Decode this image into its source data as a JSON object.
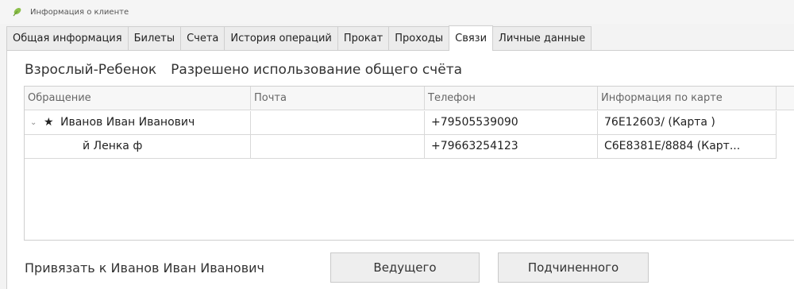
{
  "window": {
    "title": "Информация о клиенте",
    "icon": "leaf-icon"
  },
  "tabs": [
    {
      "label": "Общая информация",
      "active": false
    },
    {
      "label": "Билеты",
      "active": false
    },
    {
      "label": "Счета",
      "active": false
    },
    {
      "label": "История операций",
      "active": false
    },
    {
      "label": "Прокат",
      "active": false
    },
    {
      "label": "Проходы",
      "active": false
    },
    {
      "label": "Связи",
      "active": true
    },
    {
      "label": "Личные данные",
      "active": false
    }
  ],
  "relations": {
    "type_label": "Взрослый-Ребенок",
    "permission_label": "Разрешено использование общего счёта"
  },
  "table": {
    "columns": [
      "Обращение",
      "Почта",
      "Телефон",
      "Информация по карте",
      ""
    ],
    "rows": [
      {
        "expander": "⌄",
        "marker": "★",
        "name": "Иванов Иван Иванович",
        "email": "",
        "phone": "+79505539090",
        "card": "76E12603/ (Карта )"
      },
      {
        "name": "й Ленка ф",
        "email": "",
        "phone": "+79663254123",
        "card": "C6E8381E/8884 (Карт..."
      }
    ]
  },
  "bind": {
    "label": "Привязать к Иванов Иван Иванович",
    "lead_button": "Ведущего",
    "sub_button": "Подчиненного"
  },
  "colors": {
    "accent_icon": "#8bbf4a",
    "tab_active": "#ffffff",
    "tab_inactive": "#ececec"
  }
}
